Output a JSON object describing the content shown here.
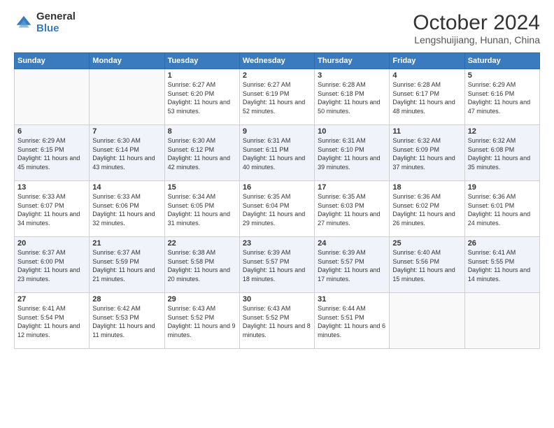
{
  "logo": {
    "general": "General",
    "blue": "Blue"
  },
  "title": "October 2024",
  "location": "Lengshuijiang, Hunan, China",
  "days_of_week": [
    "Sunday",
    "Monday",
    "Tuesday",
    "Wednesday",
    "Thursday",
    "Friday",
    "Saturday"
  ],
  "weeks": [
    [
      {
        "day": "",
        "sunrise": "",
        "sunset": "",
        "daylight": ""
      },
      {
        "day": "",
        "sunrise": "",
        "sunset": "",
        "daylight": ""
      },
      {
        "day": "1",
        "sunrise": "Sunrise: 6:27 AM",
        "sunset": "Sunset: 6:20 PM",
        "daylight": "Daylight: 11 hours and 53 minutes."
      },
      {
        "day": "2",
        "sunrise": "Sunrise: 6:27 AM",
        "sunset": "Sunset: 6:19 PM",
        "daylight": "Daylight: 11 hours and 52 minutes."
      },
      {
        "day": "3",
        "sunrise": "Sunrise: 6:28 AM",
        "sunset": "Sunset: 6:18 PM",
        "daylight": "Daylight: 11 hours and 50 minutes."
      },
      {
        "day": "4",
        "sunrise": "Sunrise: 6:28 AM",
        "sunset": "Sunset: 6:17 PM",
        "daylight": "Daylight: 11 hours and 48 minutes."
      },
      {
        "day": "5",
        "sunrise": "Sunrise: 6:29 AM",
        "sunset": "Sunset: 6:16 PM",
        "daylight": "Daylight: 11 hours and 47 minutes."
      }
    ],
    [
      {
        "day": "6",
        "sunrise": "Sunrise: 6:29 AM",
        "sunset": "Sunset: 6:15 PM",
        "daylight": "Daylight: 11 hours and 45 minutes."
      },
      {
        "day": "7",
        "sunrise": "Sunrise: 6:30 AM",
        "sunset": "Sunset: 6:14 PM",
        "daylight": "Daylight: 11 hours and 43 minutes."
      },
      {
        "day": "8",
        "sunrise": "Sunrise: 6:30 AM",
        "sunset": "Sunset: 6:12 PM",
        "daylight": "Daylight: 11 hours and 42 minutes."
      },
      {
        "day": "9",
        "sunrise": "Sunrise: 6:31 AM",
        "sunset": "Sunset: 6:11 PM",
        "daylight": "Daylight: 11 hours and 40 minutes."
      },
      {
        "day": "10",
        "sunrise": "Sunrise: 6:31 AM",
        "sunset": "Sunset: 6:10 PM",
        "daylight": "Daylight: 11 hours and 39 minutes."
      },
      {
        "day": "11",
        "sunrise": "Sunrise: 6:32 AM",
        "sunset": "Sunset: 6:09 PM",
        "daylight": "Daylight: 11 hours and 37 minutes."
      },
      {
        "day": "12",
        "sunrise": "Sunrise: 6:32 AM",
        "sunset": "Sunset: 6:08 PM",
        "daylight": "Daylight: 11 hours and 35 minutes."
      }
    ],
    [
      {
        "day": "13",
        "sunrise": "Sunrise: 6:33 AM",
        "sunset": "Sunset: 6:07 PM",
        "daylight": "Daylight: 11 hours and 34 minutes."
      },
      {
        "day": "14",
        "sunrise": "Sunrise: 6:33 AM",
        "sunset": "Sunset: 6:06 PM",
        "daylight": "Daylight: 11 hours and 32 minutes."
      },
      {
        "day": "15",
        "sunrise": "Sunrise: 6:34 AM",
        "sunset": "Sunset: 6:05 PM",
        "daylight": "Daylight: 11 hours and 31 minutes."
      },
      {
        "day": "16",
        "sunrise": "Sunrise: 6:35 AM",
        "sunset": "Sunset: 6:04 PM",
        "daylight": "Daylight: 11 hours and 29 minutes."
      },
      {
        "day": "17",
        "sunrise": "Sunrise: 6:35 AM",
        "sunset": "Sunset: 6:03 PM",
        "daylight": "Daylight: 11 hours and 27 minutes."
      },
      {
        "day": "18",
        "sunrise": "Sunrise: 6:36 AM",
        "sunset": "Sunset: 6:02 PM",
        "daylight": "Daylight: 11 hours and 26 minutes."
      },
      {
        "day": "19",
        "sunrise": "Sunrise: 6:36 AM",
        "sunset": "Sunset: 6:01 PM",
        "daylight": "Daylight: 11 hours and 24 minutes."
      }
    ],
    [
      {
        "day": "20",
        "sunrise": "Sunrise: 6:37 AM",
        "sunset": "Sunset: 6:00 PM",
        "daylight": "Daylight: 11 hours and 23 minutes."
      },
      {
        "day": "21",
        "sunrise": "Sunrise: 6:37 AM",
        "sunset": "Sunset: 5:59 PM",
        "daylight": "Daylight: 11 hours and 21 minutes."
      },
      {
        "day": "22",
        "sunrise": "Sunrise: 6:38 AM",
        "sunset": "Sunset: 5:58 PM",
        "daylight": "Daylight: 11 hours and 20 minutes."
      },
      {
        "day": "23",
        "sunrise": "Sunrise: 6:39 AM",
        "sunset": "Sunset: 5:57 PM",
        "daylight": "Daylight: 11 hours and 18 minutes."
      },
      {
        "day": "24",
        "sunrise": "Sunrise: 6:39 AM",
        "sunset": "Sunset: 5:57 PM",
        "daylight": "Daylight: 11 hours and 17 minutes."
      },
      {
        "day": "25",
        "sunrise": "Sunrise: 6:40 AM",
        "sunset": "Sunset: 5:56 PM",
        "daylight": "Daylight: 11 hours and 15 minutes."
      },
      {
        "day": "26",
        "sunrise": "Sunrise: 6:41 AM",
        "sunset": "Sunset: 5:55 PM",
        "daylight": "Daylight: 11 hours and 14 minutes."
      }
    ],
    [
      {
        "day": "27",
        "sunrise": "Sunrise: 6:41 AM",
        "sunset": "Sunset: 5:54 PM",
        "daylight": "Daylight: 11 hours and 12 minutes."
      },
      {
        "day": "28",
        "sunrise": "Sunrise: 6:42 AM",
        "sunset": "Sunset: 5:53 PM",
        "daylight": "Daylight: 11 hours and 11 minutes."
      },
      {
        "day": "29",
        "sunrise": "Sunrise: 6:43 AM",
        "sunset": "Sunset: 5:52 PM",
        "daylight": "Daylight: 11 hours and 9 minutes."
      },
      {
        "day": "30",
        "sunrise": "Sunrise: 6:43 AM",
        "sunset": "Sunset: 5:52 PM",
        "daylight": "Daylight: 11 hours and 8 minutes."
      },
      {
        "day": "31",
        "sunrise": "Sunrise: 6:44 AM",
        "sunset": "Sunset: 5:51 PM",
        "daylight": "Daylight: 11 hours and 6 minutes."
      },
      {
        "day": "",
        "sunrise": "",
        "sunset": "",
        "daylight": ""
      },
      {
        "day": "",
        "sunrise": "",
        "sunset": "",
        "daylight": ""
      }
    ]
  ]
}
